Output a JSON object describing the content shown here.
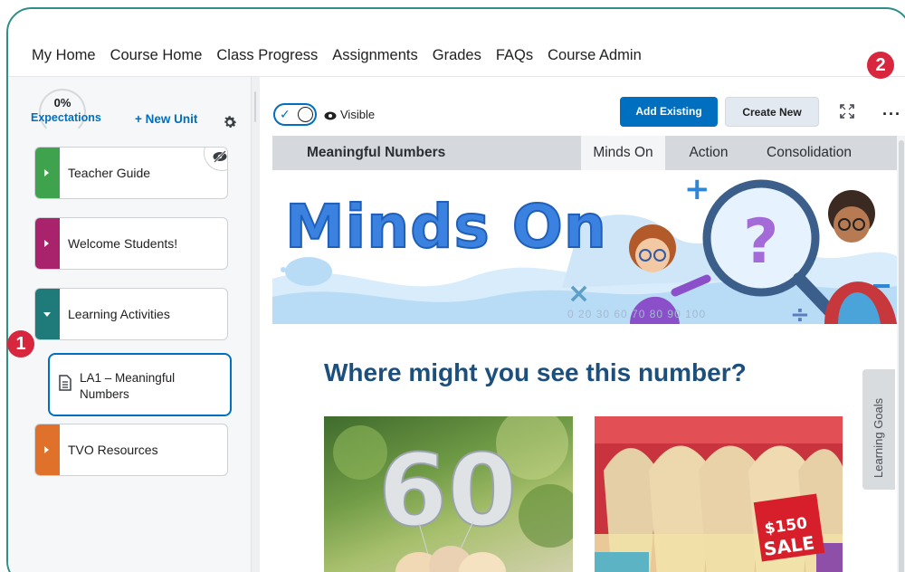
{
  "nav": {
    "items": [
      "My Home",
      "Course Home",
      "Class Progress",
      "Assignments",
      "Grades",
      "FAQs",
      "Course Admin"
    ]
  },
  "left": {
    "progress_percent": "0%",
    "progress_label": "Expectations",
    "new_unit_label": "+ New Unit",
    "units": [
      {
        "label": "Teacher Guide",
        "color": "#3fa34d",
        "hidden": true
      },
      {
        "label": "Welcome Students!",
        "color": "#a8236b"
      },
      {
        "label": "Learning Activities",
        "color": "#1f7a7a",
        "expanded": true
      },
      {
        "label": "TVO Resources",
        "color": "#e0712a"
      }
    ],
    "activity": {
      "label": "LA1 – Meaningful Numbers"
    }
  },
  "markers": [
    "1",
    "2"
  ],
  "toolbar": {
    "visible_label": "Visible",
    "add_existing": "Add Existing",
    "create_new": "Create New"
  },
  "content": {
    "unit_name": "Meaningful Numbers",
    "tabs": [
      "Minds On",
      "Action",
      "Consolidation"
    ],
    "active_tab": "Minds On",
    "banner_title": "Minds On",
    "banner_numbers": "0 20 30 60 70 80 90 100",
    "heading": "Where might you see this number?",
    "photo2_sign_price": "$150",
    "photo2_sign_text": "SALE",
    "side_tab": "Learning Goals"
  },
  "colors": {
    "accent": "#006fbf",
    "frame": "#2f8f86",
    "marker": "#d7263d"
  }
}
